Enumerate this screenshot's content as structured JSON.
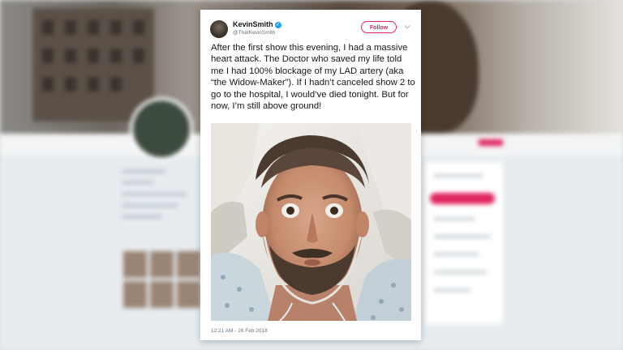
{
  "tweet": {
    "author_name": "KevinSmith",
    "verified_icon": "verified-badge-icon",
    "handle": "@ThatKevinSmith",
    "follow_label": "Follow",
    "text": "After the first show this evening, I had a massive heart attack. The Doctor who saved my life told me I had 100% blockage of my LAD artery (aka “the Widow-Maker”). If I hadn’t canceled show 2 to go to the hospital, I would’ve died tonight. But for now, I’m still above ground!",
    "timestamp": "12:21 AM - 26 Feb 2018",
    "photo": "selfie-hospital-bed"
  },
  "colors": {
    "follow_accent": "#e0245e",
    "verified_blue": "#1da1f2",
    "text_dark": "#14171a",
    "text_gray": "#657786"
  }
}
